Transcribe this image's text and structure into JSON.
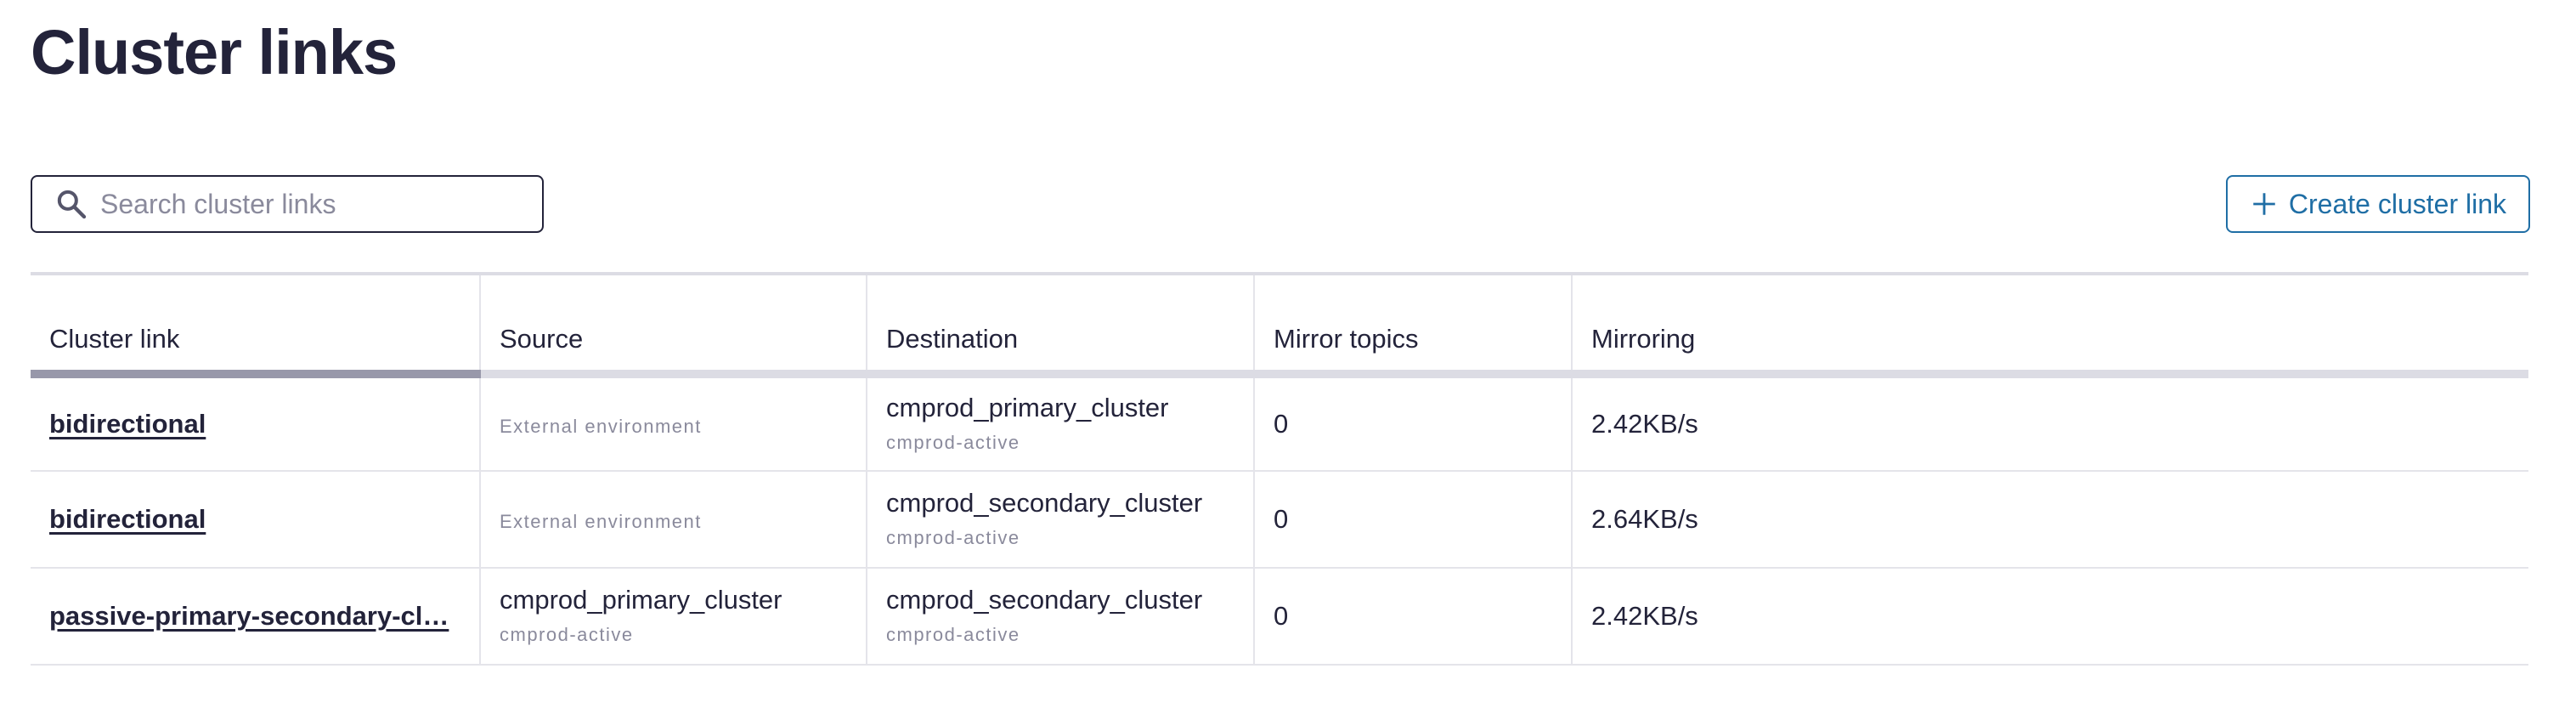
{
  "page": {
    "title": "Cluster links"
  },
  "search": {
    "placeholder": "Search cluster links",
    "value": ""
  },
  "toolbar": {
    "create_label": "Create cluster link"
  },
  "table": {
    "columns": [
      "Cluster link",
      "Source",
      "Destination",
      "Mirror topics",
      "Mirroring"
    ],
    "sorted_column": "Cluster link",
    "rows": [
      {
        "cluster_link": "bidirectional",
        "source": {
          "name": "",
          "sub": "External environment"
        },
        "destination": {
          "name": "cmprod_primary_cluster",
          "sub": "cmprod-active"
        },
        "mirror_topics": "0",
        "mirroring": "2.42KB/s"
      },
      {
        "cluster_link": "bidirectional",
        "source": {
          "name": "",
          "sub": "External environment"
        },
        "destination": {
          "name": "cmprod_secondary_cluster",
          "sub": "cmprod-active"
        },
        "mirror_topics": "0",
        "mirroring": "2.64KB/s"
      },
      {
        "cluster_link": "passive-primary-secondary-cl…",
        "source": {
          "name": "cmprod_primary_cluster",
          "sub": "cmprod-active"
        },
        "destination": {
          "name": "cmprod_secondary_cluster",
          "sub": "cmprod-active"
        },
        "mirror_topics": "0",
        "mirroring": "2.42KB/s"
      }
    ]
  },
  "colors": {
    "accent": "#1f6ea5",
    "text": "#23233a",
    "muted": "#8a8a9c",
    "border": "#dcdce4"
  },
  "icons": {
    "search": "search-icon",
    "create": "plus-icon"
  }
}
